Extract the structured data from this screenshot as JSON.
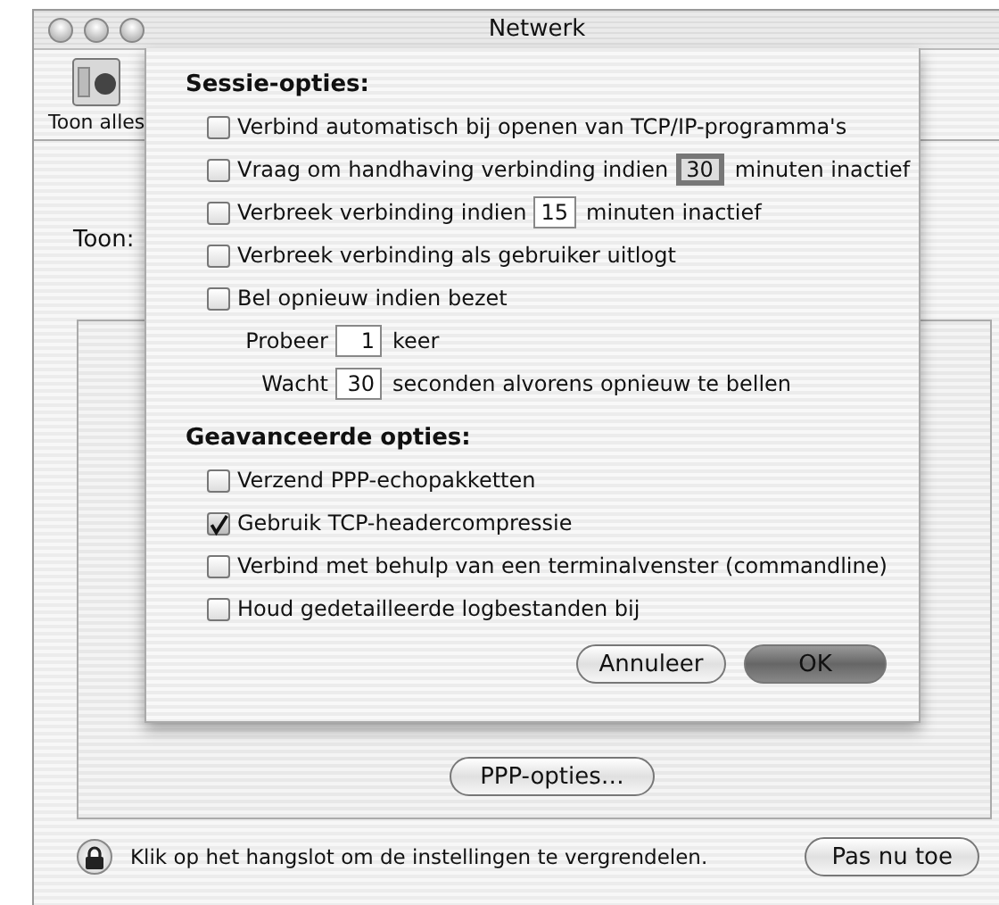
{
  "window": {
    "title": "Netwerk"
  },
  "toolbar": {
    "show_all": "Toon alles"
  },
  "show_label": "Toon:",
  "sheet": {
    "session_heading": "Sessie-opties:",
    "session_options": [
      {
        "kind": "checkbox",
        "label": "Verbind automatisch bij openen van TCP/IP-programma's",
        "checked": false
      },
      {
        "kind": "checkbox_field",
        "label": "Vraag om handhaving verbinding indien",
        "value": "30",
        "suffix": "minuten inactief",
        "checked": false,
        "focused": true
      },
      {
        "kind": "checkbox_field",
        "label": "Verbreek verbinding indien",
        "value": "15",
        "suffix": "minuten inactief",
        "checked": false,
        "focused": false
      },
      {
        "kind": "checkbox",
        "label": "Verbreek verbinding als gebruiker uitlogt",
        "checked": false
      },
      {
        "kind": "checkbox",
        "label": "Bel opnieuw indien bezet",
        "checked": false
      },
      {
        "kind": "field",
        "label": "Probeer",
        "value": "1",
        "suffix": "keer",
        "focused": false
      },
      {
        "kind": "field",
        "label": "Wacht",
        "value": "30",
        "suffix": "seconden alvorens opnieuw te bellen",
        "focused": false
      }
    ],
    "advanced_heading": "Geavanceerde opties:",
    "advanced_options": [
      {
        "label": "Verzend PPP-echopakketten",
        "checked": false
      },
      {
        "label": "Gebruik TCP-headercompressie",
        "checked": true
      },
      {
        "label": "Verbind met behulp van een terminalvenster (commandline)",
        "checked": false
      },
      {
        "label": "Houd gedetailleerde logbestanden bij",
        "checked": false
      }
    ],
    "buttons": [
      {
        "label": "Annuleer",
        "default": false
      },
      {
        "label": "OK",
        "default": true
      }
    ]
  },
  "ppp_button": "PPP-opties…",
  "lock_text": "Klik op het hangslot om de instellingen te vergrendelen.",
  "apply_button": "Pas nu toe"
}
